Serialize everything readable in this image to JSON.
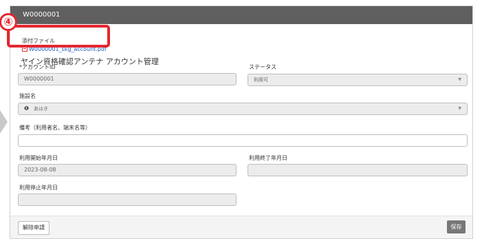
{
  "panel": {
    "title": "W0000001"
  },
  "attachment": {
    "label": "添付ファイル",
    "file_name": "W0000001_skg_account.pdf"
  },
  "annotation": {
    "step_number": "④"
  },
  "section": {
    "title": "ヤイン資格確認アンテナ アカウント管理"
  },
  "form": {
    "account_id": {
      "label": "*アカウントID",
      "value": "W0000001"
    },
    "status": {
      "label": "ステータス",
      "value": "利用可"
    },
    "facility": {
      "label": "施設名",
      "value": "あはき"
    },
    "remarks": {
      "label": "備考（利用者名、端末名等）",
      "value": ""
    },
    "start_date": {
      "label": "利用開始年月日",
      "value": "2023-08-08"
    },
    "end_date": {
      "label": "利用終了年月日",
      "value": ""
    },
    "stop_date": {
      "label": "利用停止年月日",
      "value": ""
    }
  },
  "footer": {
    "release_label": "解除申請",
    "save_label": "保存"
  },
  "colors": {
    "header_bg": "#5f5f5f",
    "highlight": "#e4262f",
    "link": "#1a56c4"
  }
}
